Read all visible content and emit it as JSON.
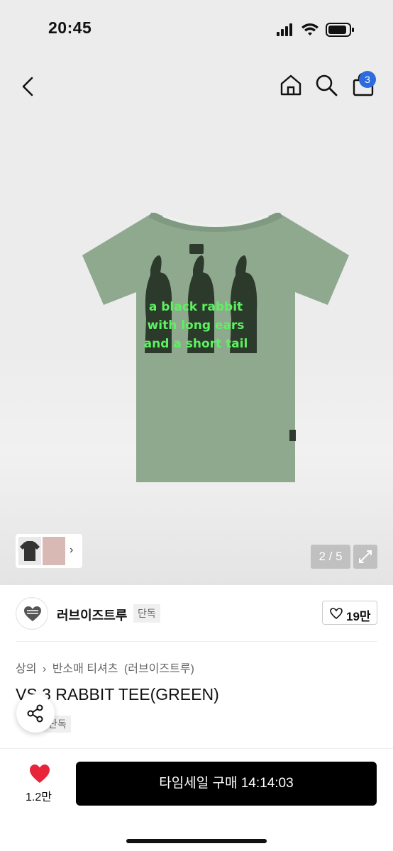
{
  "status": {
    "time": "20:45"
  },
  "nav": {
    "cart_count": "3"
  },
  "hero": {
    "print_lines": [
      "a black rabbit",
      "with long ears",
      "and a short tail"
    ],
    "page_counter": "2 / 5"
  },
  "brand": {
    "name": "러브이즈트루",
    "badge": "단독",
    "likes": "19만"
  },
  "product": {
    "breadcrumb": [
      "상의",
      "›",
      "반소매 티셔츠",
      "(러브이즈트루)"
    ],
    "title": "VS 3 RABBIT TEE(GREEN)",
    "exclusive": "단독"
  },
  "bottom": {
    "wish_count": "1.2만",
    "buy_label": "타임세일 구매 14:14:03"
  },
  "colors": {
    "tee": "#8fa98f",
    "print_text": "#5cf25f",
    "badge": "#2d6cdf",
    "heart": "#e8243b",
    "buy_button": "#000000"
  }
}
